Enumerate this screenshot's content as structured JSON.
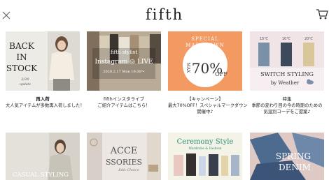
{
  "header": {
    "logo": "fifth",
    "close_icon": "close-icon",
    "cart_icon": "cart-icon"
  },
  "cards": [
    {
      "image": {
        "line1": "BACK",
        "line2": "IN",
        "line3": "STOCK",
        "date": "2/20",
        "note": "update"
      },
      "title": "再入荷",
      "subtitle": "大人気アイテムが多数再入荷しました！"
    },
    {
      "image": {
        "line1": "fifth stylist",
        "line2": "Instagram ◎ LIVE",
        "line3": "2020.2.17 Mon 19:30～"
      },
      "title": "fifthインスタライブ",
      "subtitle": "ご紹介アイテムはこちら！"
    },
    {
      "image": {
        "line1": "SPECIAL",
        "line2": "MARKDOWN",
        "max": "MAX",
        "percent": "70%",
        "off": "OFF"
      },
      "title": "【キャンペーン】",
      "subtitle": "最大70%OFF！スペシャルマークダウン",
      "subtitle2": "開催中♪"
    },
    {
      "image": {
        "temp1": "15℃",
        "temp2": "10℃",
        "temp3": "20℃",
        "line1": "SWITCH STYLING",
        "line2": "by Weather"
      },
      "title": "特集",
      "subtitle": "季節の変わり目の今の時期のための",
      "subtitle2": "気温別コーデをご提案♪"
    },
    {
      "image": {
        "line1": "CASUAL STYLING"
      }
    },
    {
      "image": {
        "line1": "ACCE",
        "line2": "SSORIES",
        "line3": "Edit Choice"
      }
    },
    {
      "image": {
        "line1": "Ceremony Style",
        "line2": "Wardrobe & Fashion"
      }
    },
    {
      "image": {
        "line1": "SPRING",
        "line2": "DENIM"
      }
    }
  ],
  "colors": {
    "markdown_bg": "#f39a62",
    "ceremony_bg": "#f3f3e8",
    "ceremony_text": "#2f8f74",
    "switch_bg": "#f6eef0"
  }
}
